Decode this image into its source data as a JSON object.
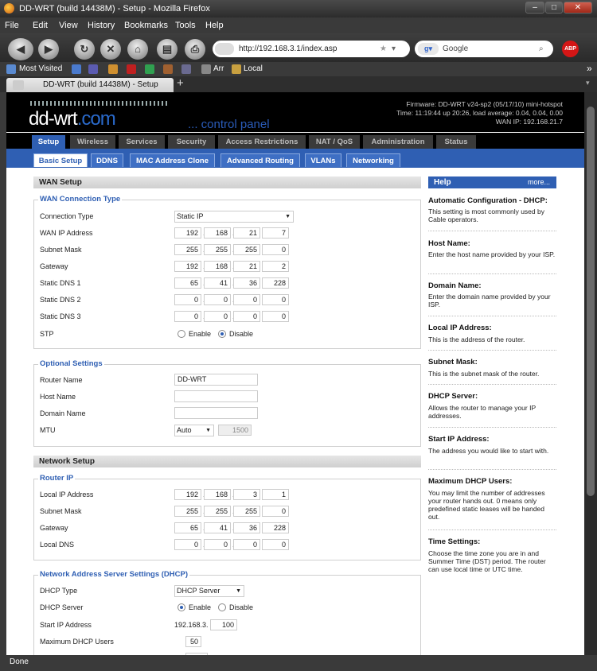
{
  "window": {
    "title": "DD-WRT (build 14438M) - Setup - Mozilla Firefox",
    "status": "Done"
  },
  "menu": [
    "File",
    "Edit",
    "View",
    "History",
    "Bookmarks",
    "Tools",
    "Help"
  ],
  "nav": {
    "url": "http://192.168.3.1/index.asp",
    "search_placeholder": "Google",
    "abp": "ABP"
  },
  "bookmarks": [
    "Most Visited",
    "Arr",
    "Local"
  ],
  "tab": {
    "title": "DD-WRT (build 14438M) - Setup",
    "new_tab": "+"
  },
  "ddwrt": {
    "logo_main": "dd-wrt",
    "logo_com": ".com",
    "control_panel": "... control panel",
    "firmware": "Firmware: DD-WRT v24-sp2 (05/17/10) mini-hotspot",
    "time": "Time: 11:19:44 up 20:26, load average: 0.04, 0.04, 0.00",
    "wan_ip": "WAN IP: 192.168.21.7",
    "main_tabs": [
      "Setup",
      "Wireless",
      "Services",
      "Security",
      "Access Restrictions",
      "NAT / QoS",
      "Administration",
      "Status"
    ],
    "sub_tabs": [
      "Basic Setup",
      "DDNS",
      "MAC Address Clone",
      "Advanced Routing",
      "VLANs",
      "Networking"
    ]
  },
  "wan": {
    "section_title": "WAN Setup",
    "legend": "WAN Connection Type",
    "connection_type_label": "Connection Type",
    "connection_type": "Static IP",
    "wan_ip_label": "WAN IP Address",
    "wan_ip": [
      "192",
      "168",
      "21",
      "7"
    ],
    "subnet_label": "Subnet Mask",
    "subnet": [
      "255",
      "255",
      "255",
      "0"
    ],
    "gateway_label": "Gateway",
    "gateway": [
      "192",
      "168",
      "21",
      "2"
    ],
    "dns1_label": "Static DNS 1",
    "dns1": [
      "65",
      "41",
      "36",
      "228"
    ],
    "dns2_label": "Static DNS 2",
    "dns2": [
      "0",
      "0",
      "0",
      "0"
    ],
    "dns3_label": "Static DNS 3",
    "dns3": [
      "0",
      "0",
      "0",
      "0"
    ],
    "stp_label": "STP",
    "enable": "Enable",
    "disable": "Disable"
  },
  "optional": {
    "legend": "Optional Settings",
    "router_name_label": "Router Name",
    "router_name": "DD-WRT",
    "host_name_label": "Host Name",
    "host_name": "",
    "domain_name_label": "Domain Name",
    "domain_name": "",
    "mtu_label": "MTU",
    "mtu_mode": "Auto",
    "mtu_value": "1500"
  },
  "network": {
    "section_title": "Network Setup",
    "legend": "Router IP",
    "local_ip_label": "Local IP Address",
    "local_ip": [
      "192",
      "168",
      "3",
      "1"
    ],
    "subnet_label": "Subnet Mask",
    "subnet": [
      "255",
      "255",
      "255",
      "0"
    ],
    "gateway_label": "Gateway",
    "gateway": [
      "65",
      "41",
      "36",
      "228"
    ],
    "dns_label": "Local DNS",
    "dns": [
      "0",
      "0",
      "0",
      "0"
    ]
  },
  "dhcp": {
    "legend": "Network Address Server Settings (DHCP)",
    "type_label": "DHCP Type",
    "type": "DHCP Server",
    "server_label": "DHCP Server",
    "enable": "Enable",
    "disable": "Disable",
    "start_label": "Start IP Address",
    "start_prefix": "192.168.3.",
    "start_value": "100",
    "max_label": "Maximum DHCP Users",
    "max_value": "50"
  },
  "help": {
    "title": "Help",
    "more": "more...",
    "items": [
      {
        "title": "Automatic Configuration - DHCP:",
        "text": "This setting is most commonly used by Cable operators."
      },
      {
        "title": "Host Name:",
        "text": "Enter the host name provided by your ISP."
      },
      {
        "title": "Domain Name:",
        "text": "Enter the domain name provided by your ISP."
      },
      {
        "title": "Local IP Address:",
        "text": "This is the address of the router."
      },
      {
        "title": "Subnet Mask:",
        "text": "This is the subnet mask of the router."
      },
      {
        "title": "DHCP Server:",
        "text": "Allows the router to manage your IP addresses."
      },
      {
        "title": "Start IP Address:",
        "text": "The address you would like to start with."
      },
      {
        "title": "Maximum DHCP Users:",
        "text": "You may limit the number of addresses your router hands out. 0 means only predefined static leases will be handed out."
      },
      {
        "title": "Time Settings:",
        "text": "Choose the time zone you are in and Summer Time (DST) period. The router can use local time or UTC time."
      }
    ]
  }
}
